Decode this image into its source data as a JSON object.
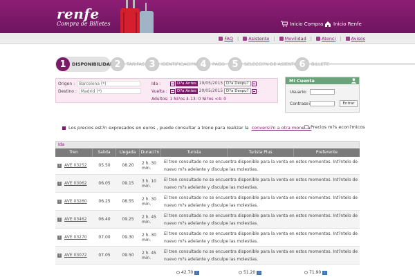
{
  "header": {
    "brand": "renfe",
    "subtitle": "Compra de Billetes",
    "inicio_compra": "Inicio Compra",
    "inicio_renfe": "Inicio Renfe"
  },
  "util_links": [
    "FAQ",
    "Asistente",
    "Movilidad",
    "Atenci",
    "Avisos"
  ],
  "steps": [
    {
      "num": "1",
      "label": "DISPONIBILIDAD"
    },
    {
      "num": "2",
      "label": "TARIFAS"
    },
    {
      "num": "3",
      "label": "IDENTIFICACI?N"
    },
    {
      "num": "4",
      "label": "PAGO"
    },
    {
      "num": "5",
      "label": "SELECCI?N DE ASIENTO"
    },
    {
      "num": "6",
      "label": "BILLETE"
    }
  ],
  "search": {
    "origen_label": "Origen :",
    "origen_value": "Barcelona (*)",
    "destino_label": "Destino :",
    "destino_value": "Madrid (*)",
    "ida_label": "Ida :",
    "vuelta_label": "Vuelta :",
    "antes": "D?a Antes",
    "despues": "D?a Despu?",
    "ida_date": "19/05/2015",
    "vuelta_date": "20/05/2015",
    "pax": "Adultos: 1   Ni?os 4-13: 0   Ni?os <4: 0"
  },
  "login": {
    "title": "Mi Cuenta",
    "usuario": "Usuario:",
    "contrasena": "Contrase?",
    "entrar": "Entrar"
  },
  "note": {
    "text": "Los precios est?n expresados en euros , puede consultar a trene para realizar la",
    "link": "conversi?n a otra moneda.",
    "econ": "Precios m?s econ?micos"
  },
  "table": {
    "ida": "Ida",
    "headers": [
      "Tren",
      "Salida",
      "Llegada",
      "Duraci?n",
      "Turista",
      "Turista Plus",
      "Preferente"
    ],
    "message": "El tren consultado no se encuentra disponible para la venta en estos momentos. Int?ntelo de nuevo m?s adelante y disculpe las molestias.",
    "rows": [
      {
        "tren": "AVE 03252",
        "salida": "05.50",
        "llegada": "08.20",
        "dur": "2 h. 30 min."
      },
      {
        "tren": "AVE 03062",
        "salida": "06.05",
        "llegada": "09.15",
        "dur": "3 h. 10 min."
      },
      {
        "tren": "AVE 03260",
        "salida": "06.25",
        "llegada": "08.55",
        "dur": "2 h. 30 min."
      },
      {
        "tren": "AVE 03462",
        "salida": "06.40",
        "llegada": "09.25",
        "dur": "2 h. 45 min."
      },
      {
        "tren": "AVE 03270",
        "salida": "07.00",
        "llegada": "09.30",
        "dur": "2 h. 30 min."
      },
      {
        "tren": "AVE 03072",
        "salida": "07.05",
        "llegada": "09.50",
        "dur": "2 h. 45 min."
      }
    ],
    "prices": [
      "42.70",
      "51.20",
      "71.90"
    ]
  },
  "colors": {
    "brand": "#7a1a68",
    "login_header": "#6aa37b"
  }
}
